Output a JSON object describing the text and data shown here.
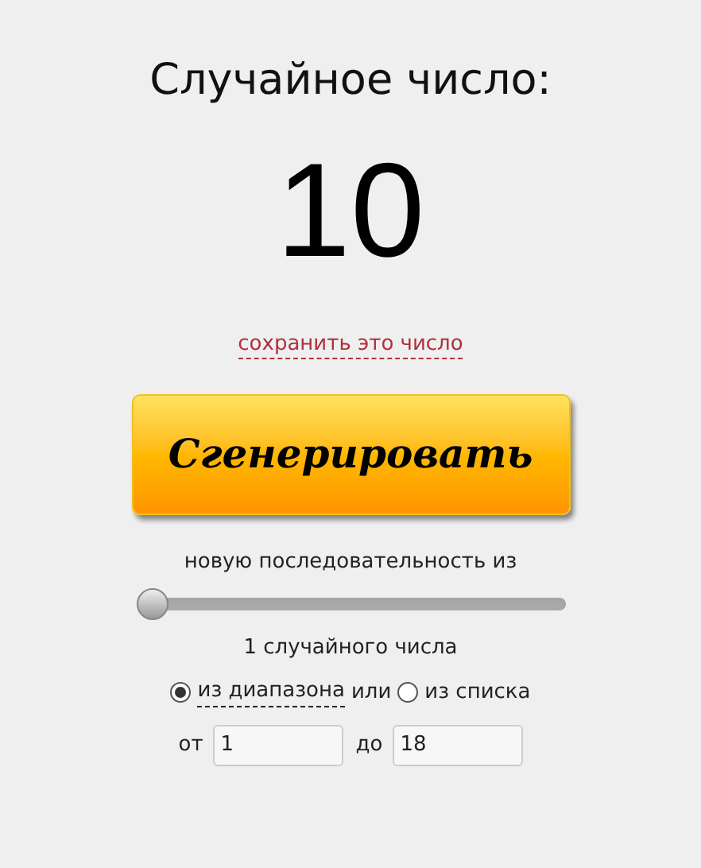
{
  "title": "Случайное число:",
  "result": "10",
  "save_link": "сохранить это число",
  "generate_button": "Сгенерировать",
  "sequence_label": "новую последовательность из",
  "count_slider": {
    "level": 0
  },
  "count_label": "1 случайного числа",
  "source_options": [
    {
      "label": "из диапазона",
      "selected": true
    },
    {
      "label": "из списка",
      "selected": false
    }
  ],
  "or_text": "или",
  "range": {
    "from_label": "от",
    "from_value": "1",
    "to_label": "до",
    "to_value": "18"
  }
}
